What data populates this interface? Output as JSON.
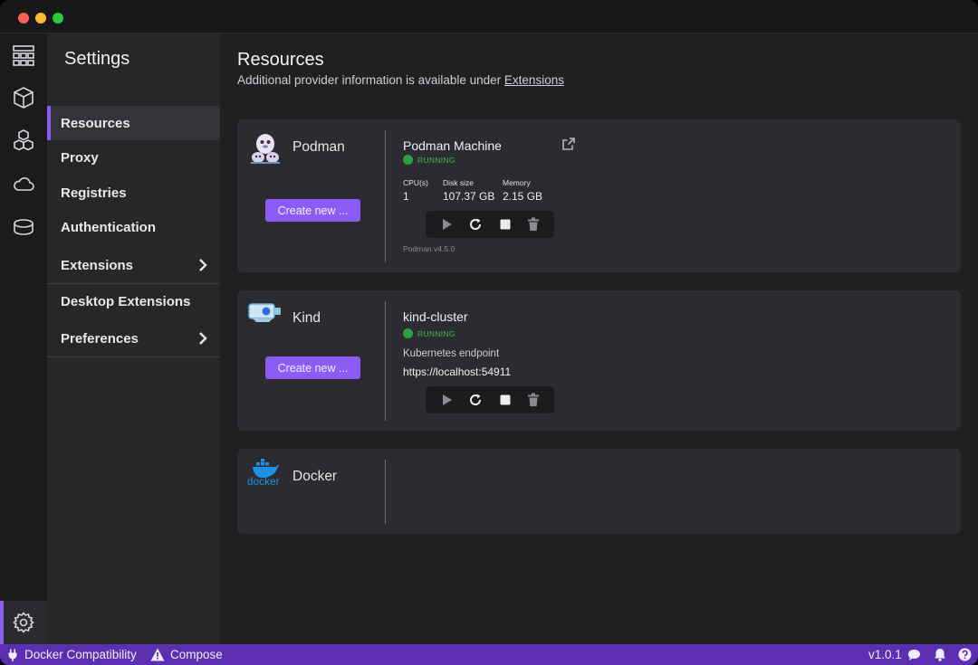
{
  "window": {
    "traffic_lights": [
      "close",
      "minimize",
      "maximize"
    ]
  },
  "iconbar": {
    "items": [
      {
        "name": "dashboard-icon"
      },
      {
        "name": "containers-icon"
      },
      {
        "name": "pods-icon"
      },
      {
        "name": "images-icon"
      },
      {
        "name": "volumes-icon"
      }
    ],
    "settings": {
      "name": "settings-icon"
    }
  },
  "settings_nav": {
    "title": "Settings",
    "items": [
      {
        "label": "Resources",
        "active": true
      },
      {
        "label": "Proxy"
      },
      {
        "label": "Registries"
      },
      {
        "label": "Authentication"
      },
      {
        "label": "Extensions",
        "has_chevron": true
      },
      {
        "label": "Desktop Extensions"
      },
      {
        "label": "Preferences",
        "has_chevron": true
      }
    ]
  },
  "main": {
    "title": "Resources",
    "subtitle_prefix": "Additional provider information is available under ",
    "subtitle_link": "Extensions"
  },
  "providers": [
    {
      "name": "Podman",
      "create_label": "Create new ...",
      "machine": {
        "name": "Podman Machine",
        "status": "RUNNING",
        "cpu_label": "CPU(s)",
        "cpu_value": "1",
        "disk_label": "Disk size",
        "disk_value": "107.37 GB",
        "memory_label": "Memory",
        "memory_value": "2.15 GB",
        "version": "Podman v4.5.0"
      }
    },
    {
      "name": "Kind",
      "create_label": "Create new ...",
      "machine": {
        "name": "kind-cluster",
        "status": "RUNNING",
        "endpoint_label": "Kubernetes endpoint",
        "endpoint_value": "https://localhost:54911"
      }
    },
    {
      "name": "Docker",
      "logo_text": "docker"
    }
  ],
  "statusbar": {
    "docker_compat": "Docker Compatibility",
    "compose": "Compose",
    "version": "v1.0.1"
  },
  "colors": {
    "accent": "#8b5cf6",
    "running": "#2ea043",
    "statusbar": "#5b2fb0"
  }
}
